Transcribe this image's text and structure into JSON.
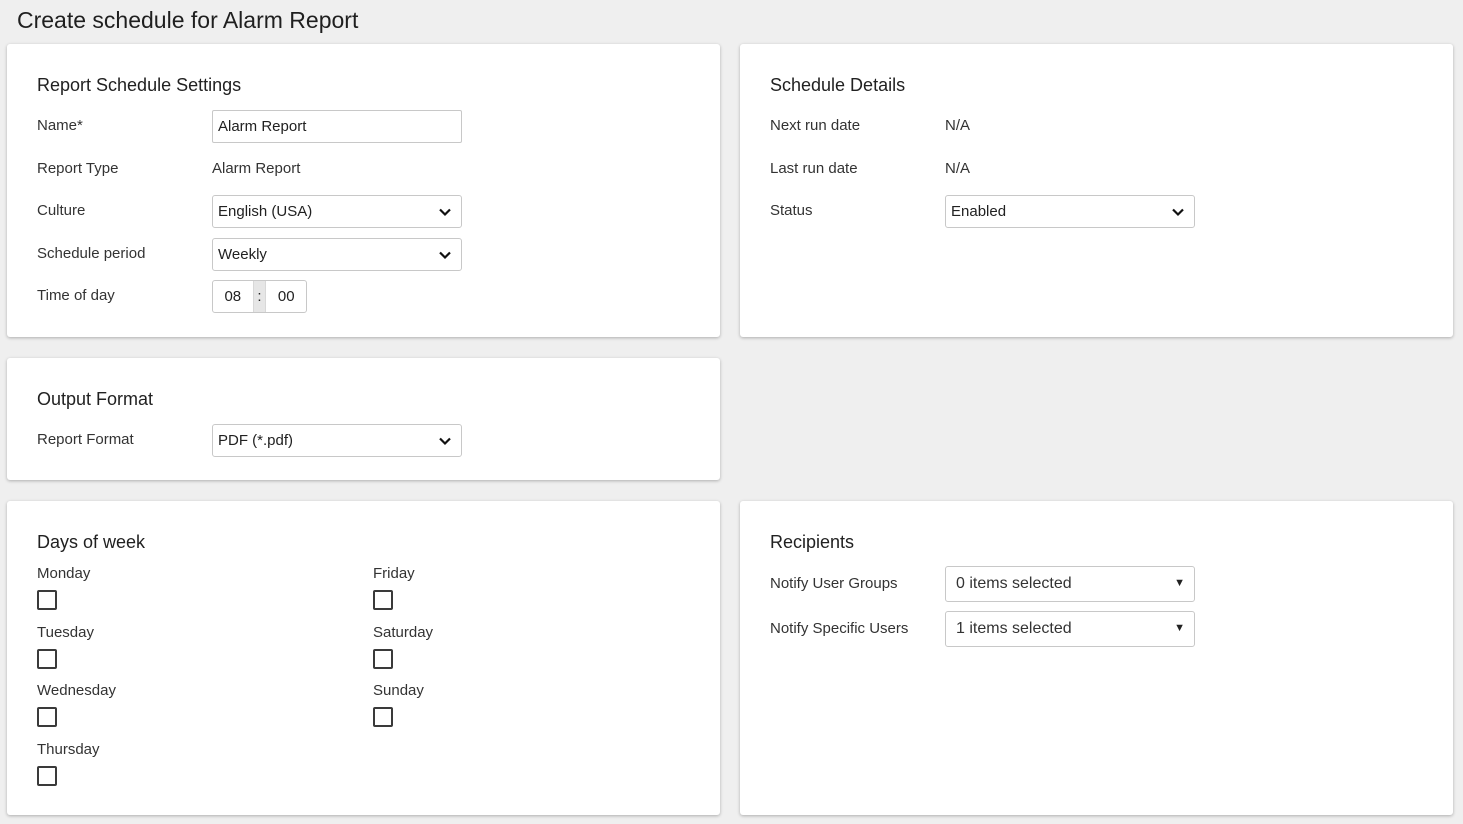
{
  "page": {
    "title": "Create schedule for Alarm Report"
  },
  "settings": {
    "title": "Report Schedule Settings",
    "name_label": "Name*",
    "name_value": "Alarm Report",
    "report_type_label": "Report Type",
    "report_type_value": "Alarm Report",
    "culture_label": "Culture",
    "culture_value": "English (USA)",
    "period_label": "Schedule period",
    "period_value": "Weekly",
    "time_label": "Time of day",
    "time_hours": "08",
    "time_sep": ":",
    "time_minutes": "00"
  },
  "details": {
    "title": "Schedule Details",
    "next_run_label": "Next run date",
    "next_run_value": "N/A",
    "last_run_label": "Last run date",
    "last_run_value": "N/A",
    "status_label": "Status",
    "status_value": "Enabled"
  },
  "output": {
    "title": "Output Format",
    "format_label": "Report Format",
    "format_value": "PDF (*.pdf)"
  },
  "days": {
    "title": "Days of week",
    "items": [
      {
        "label": "Monday",
        "checked": false
      },
      {
        "label": "Tuesday",
        "checked": false
      },
      {
        "label": "Wednesday",
        "checked": false
      },
      {
        "label": "Thursday",
        "checked": false
      },
      {
        "label": "Friday",
        "checked": false
      },
      {
        "label": "Saturday",
        "checked": false
      },
      {
        "label": "Sunday",
        "checked": false
      }
    ]
  },
  "recipients": {
    "title": "Recipients",
    "groups_label": "Notify User Groups",
    "groups_value": "0 items selected",
    "users_label": "Notify Specific Users",
    "users_value": "1 items selected",
    "caret": "▼"
  },
  "icons": {
    "dropdown": "chevron-down-icon"
  }
}
